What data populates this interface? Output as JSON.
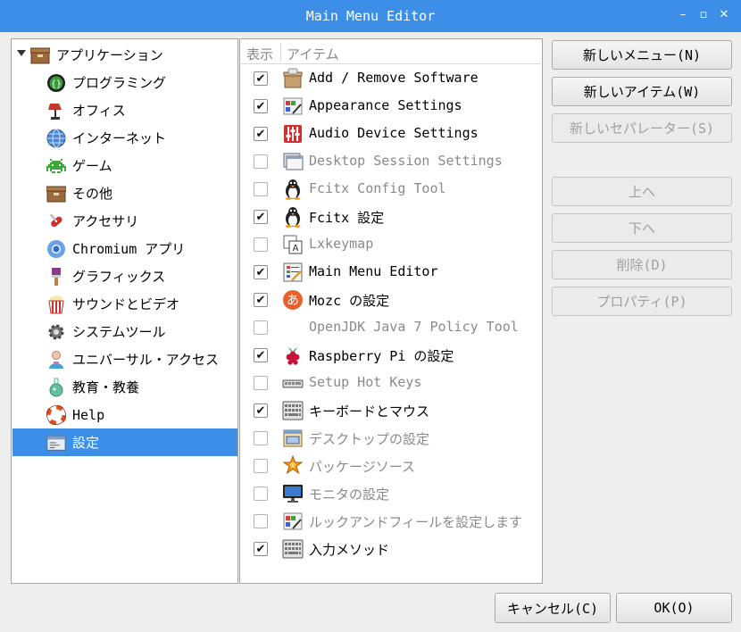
{
  "window": {
    "title": "Main Menu Editor"
  },
  "tree": {
    "root": {
      "label": "アプリケーション"
    },
    "items": [
      {
        "label": "プログラミング",
        "icon": "programming-icon",
        "color": "#2f8f2f"
      },
      {
        "label": "オフィス",
        "icon": "office-lamp-icon",
        "color": "#c0392b"
      },
      {
        "label": "インターネット",
        "icon": "globe-icon",
        "color": "#3c78c8"
      },
      {
        "label": "ゲーム",
        "icon": "space-invader-icon",
        "color": "#3ca83c"
      },
      {
        "label": "その他",
        "icon": "box-icon",
        "color": "#8b5a2b"
      },
      {
        "label": "アクセサリ",
        "icon": "swiss-knife-icon",
        "color": "#d03030"
      },
      {
        "label": "Chromium アプリ",
        "icon": "chromium-icon",
        "color": "#4a8ee0"
      },
      {
        "label": "グラフィックス",
        "icon": "paintbrush-icon",
        "color": "#8a3a8a"
      },
      {
        "label": "サウンドとビデオ",
        "icon": "popcorn-icon",
        "color": "#d03030"
      },
      {
        "label": "システムツール",
        "icon": "gear-icon",
        "color": "#555555"
      },
      {
        "label": "ユニバーサル・アクセス",
        "icon": "person-icon",
        "color": "#e07090"
      },
      {
        "label": "教育・教養",
        "icon": "flask-icon",
        "color": "#40a080"
      },
      {
        "label": "Help",
        "icon": "lifebuoy-icon",
        "color": "#e05020"
      },
      {
        "label": "設定",
        "icon": "settings-panel-icon",
        "color": "#ffffff",
        "selected": true
      }
    ]
  },
  "list": {
    "header": {
      "show": "表示",
      "item": "アイテム"
    },
    "items": [
      {
        "label": "Add / Remove Software",
        "checked": true,
        "icon": "package-icon"
      },
      {
        "label": "Appearance Settings",
        "checked": true,
        "icon": "appearance-icon"
      },
      {
        "label": "Audio Device Settings",
        "checked": true,
        "icon": "audio-mixer-icon"
      },
      {
        "label": "Desktop Session Settings",
        "checked": false,
        "icon": "desktop-session-icon"
      },
      {
        "label": "Fcitx Config Tool",
        "checked": false,
        "icon": "penguin-icon"
      },
      {
        "label": "Fcitx 設定",
        "checked": true,
        "icon": "penguin-icon"
      },
      {
        "label": "Lxkeymap",
        "checked": false,
        "icon": "keymap-icon"
      },
      {
        "label": "Main Menu Editor",
        "checked": true,
        "icon": "menu-editor-icon"
      },
      {
        "label": "Mozc の設定",
        "checked": true,
        "icon": "mozc-icon"
      },
      {
        "label": "OpenJDK Java 7 Policy Tool",
        "checked": false,
        "icon": ""
      },
      {
        "label": "Raspberry Pi の設定",
        "checked": true,
        "icon": "raspberry-icon"
      },
      {
        "label": "Setup Hot Keys",
        "checked": false,
        "icon": "hotkeys-icon"
      },
      {
        "label": "キーボードとマウス",
        "checked": true,
        "icon": "keyboard-icon"
      },
      {
        "label": "デスクトップの設定",
        "checked": false,
        "icon": "desktop-icon"
      },
      {
        "label": "パッケージソース",
        "checked": false,
        "icon": "package-source-icon"
      },
      {
        "label": "モニタの設定",
        "checked": false,
        "icon": "monitor-icon"
      },
      {
        "label": "ルックアンドフィールを設定します",
        "checked": false,
        "icon": "appearance-icon"
      },
      {
        "label": "入力メソッド",
        "checked": true,
        "icon": "keyboard-icon"
      }
    ]
  },
  "buttons": {
    "new_menu": "新しいメニュー(N)",
    "new_item": "新しいアイテム(W)",
    "new_separator": "新しいセパレーター(S)",
    "move_up": "上へ",
    "move_down": "下へ",
    "delete": "削除(D)",
    "properties": "プロパティ(P)",
    "cancel": "キャンセル(C)",
    "ok": "OK(O)"
  },
  "colors": {
    "titlebar": "#3c8ee6",
    "selection": "#3c8ee6"
  }
}
